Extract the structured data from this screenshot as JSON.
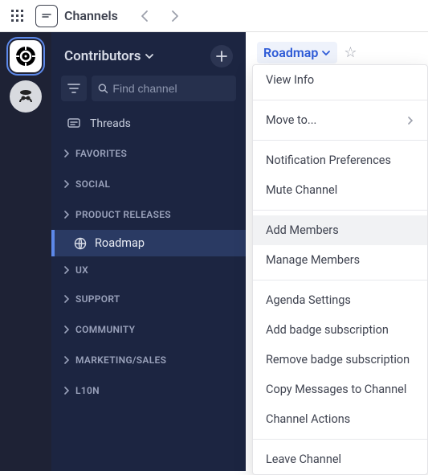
{
  "topbar": {
    "title": "Channels"
  },
  "sidebar": {
    "title": "Contributors",
    "search_placeholder": "Find channel",
    "threads_label": "Threads",
    "categories": [
      {
        "label": "FAVORITES"
      },
      {
        "label": "SOCIAL"
      },
      {
        "label": "PRODUCT RELEASES"
      },
      {
        "label": "UX"
      },
      {
        "label": "SUPPORT"
      },
      {
        "label": "COMMUNITY"
      },
      {
        "label": "MARKETING/SALES"
      },
      {
        "label": "L10N"
      }
    ],
    "active_channel": "Roadmap"
  },
  "content": {
    "channel_name": "Roadmap"
  },
  "menu": {
    "items": [
      {
        "label": "View Info"
      },
      {
        "label": "Move to...",
        "has_sub": true
      },
      {
        "label": "Notification Preferences"
      },
      {
        "label": "Mute Channel"
      },
      {
        "label": "Add Members",
        "hover": true
      },
      {
        "label": "Manage Members"
      },
      {
        "label": "Agenda Settings"
      },
      {
        "label": "Add badge subscription"
      },
      {
        "label": "Remove badge subscription"
      },
      {
        "label": "Copy Messages to Channel"
      },
      {
        "label": "Channel Actions"
      },
      {
        "label": "Leave Channel"
      }
    ]
  }
}
